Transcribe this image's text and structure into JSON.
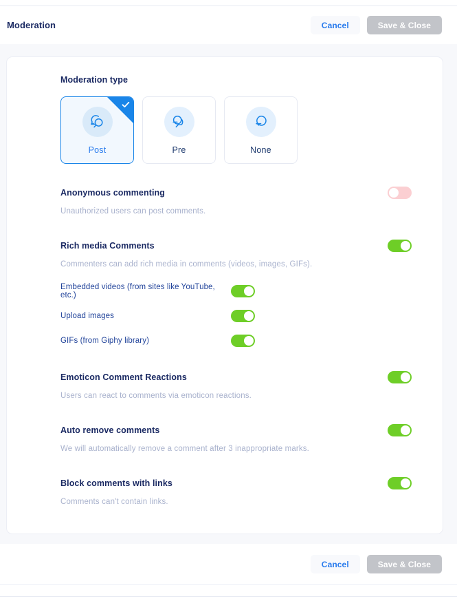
{
  "header": {
    "title": "Moderation",
    "cancel_label": "Cancel",
    "save_label": "Save & Close"
  },
  "moderation_type": {
    "label": "Moderation type",
    "selected": "Post",
    "options": [
      {
        "name": "Post",
        "icon": "speech-bubble-magnifier-icon",
        "selected": true
      },
      {
        "name": "Pre",
        "icon": "two-speech-bubbles-icon",
        "selected": false
      },
      {
        "name": "None",
        "icon": "single-speech-bubble-icon",
        "selected": false
      }
    ]
  },
  "sections": [
    {
      "title": "Anonymous commenting",
      "description": "Unauthorized users can post comments.",
      "toggle_state": "off"
    },
    {
      "title": "Rich media Comments",
      "description": "Commenters can add rich media in comments (videos, images, GIFs).",
      "toggle_state": "on",
      "subitems": [
        {
          "label": "Embedded videos (from sites like YouTube, etc.)",
          "toggle_state": "on"
        },
        {
          "label": "Upload images",
          "toggle_state": "on"
        },
        {
          "label": "GIFs (from Giphy library)",
          "toggle_state": "on"
        }
      ]
    },
    {
      "title": "Emoticon Comment Reactions",
      "description": "Users can react to comments via emoticon reactions.",
      "toggle_state": "on"
    },
    {
      "title": "Auto remove comments",
      "description": "We will automatically remove a comment after 3 inappropriate marks.",
      "toggle_state": "on"
    },
    {
      "title": "Block comments with links",
      "description": "Comments can't contain links.",
      "toggle_state": "on"
    }
  ],
  "footer": {
    "cancel_label": "Cancel",
    "save_label": "Save & Close"
  },
  "colors": {
    "accent_blue": "#2a7ced",
    "title_navy": "#1b2a63",
    "toggle_on": "#6ece27",
    "toggle_off": "#fbcfd2",
    "selected_card_border": "#1a85e8",
    "disabled_button": "#c2c4c9"
  }
}
